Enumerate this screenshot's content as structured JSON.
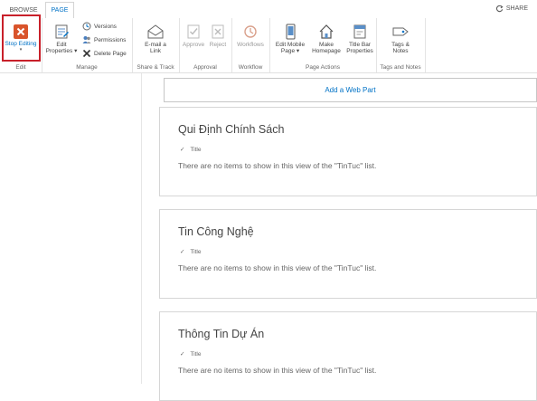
{
  "tabs": {
    "browse": "BROWSE",
    "page": "PAGE"
  },
  "share": {
    "label": "SHARE"
  },
  "ribbon": {
    "edit": {
      "stop_editing": "Stop Editing",
      "group_label": "Edit"
    },
    "manage": {
      "edit_properties_1": "Edit",
      "edit_properties_2": "Properties ▾",
      "versions": "Versions",
      "permissions": "Permissions",
      "delete_page": "Delete Page",
      "group_label": "Manage"
    },
    "share_track": {
      "email_1": "E-mail a",
      "email_2": "Link",
      "group_label": "Share & Track"
    },
    "approval": {
      "approve": "Approve",
      "reject": "Reject",
      "group_label": "Approval"
    },
    "workflow": {
      "workflows": "Workflows",
      "group_label": "Workflow"
    },
    "page_actions": {
      "edit_mobile_1": "Edit Mobile",
      "edit_mobile_2": "Page ▾",
      "make_homepage_1": "Make",
      "make_homepage_2": "Homepage",
      "title_bar_1": "Title Bar",
      "title_bar_2": "Properties",
      "group_label": "Page Actions"
    },
    "tags_notes": {
      "tags_1": "Tags &",
      "tags_2": "Notes",
      "group_label": "Tags and Notes"
    }
  },
  "add_web_part": "Add a Web Part",
  "zones": [
    {
      "title": "Qui Định Chính Sách",
      "column": "Title",
      "empty": "There are no items to show in this view of the \"TinTuc\" list."
    },
    {
      "title": "Tin Công Nghệ",
      "column": "Title",
      "empty": "There are no items to show in this view of the \"TinTuc\" list."
    },
    {
      "title": "Thông Tin Dự Án",
      "column": "Title",
      "empty": "There are no items to show in this view of the \"TinTuc\" list."
    }
  ]
}
